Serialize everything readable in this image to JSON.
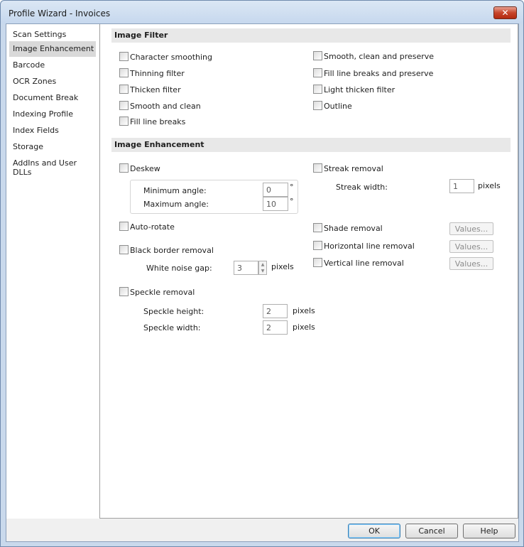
{
  "window": {
    "title": "Profile Wizard - Invoices",
    "close_glyph": "✕"
  },
  "sidebar": {
    "items": [
      {
        "label": "Scan Settings"
      },
      {
        "label": "Image Enhancement"
      },
      {
        "label": "Barcode"
      },
      {
        "label": "OCR Zones"
      },
      {
        "label": "Document Break"
      },
      {
        "label": "Indexing Profile"
      },
      {
        "label": "Index Fields"
      },
      {
        "label": "Storage"
      },
      {
        "label": "AddIns and User DLLs"
      }
    ],
    "selected": "Image Enhancement"
  },
  "image_filter": {
    "heading": "Image Filter",
    "left": [
      {
        "label": "Character smoothing",
        "checked": false
      },
      {
        "label": "Thinning filter",
        "checked": false
      },
      {
        "label": "Thicken filter",
        "checked": false
      },
      {
        "label": "Smooth and clean",
        "checked": false
      },
      {
        "label": "Fill line breaks",
        "checked": false
      }
    ],
    "right": [
      {
        "label": "Smooth, clean and preserve",
        "checked": false
      },
      {
        "label": "Fill line breaks and preserve",
        "checked": false
      },
      {
        "label": "Light thicken filter",
        "checked": false
      },
      {
        "label": "Outline",
        "checked": false
      }
    ]
  },
  "image_enhancement": {
    "heading": "Image Enhancement",
    "deskew": {
      "label": "Deskew",
      "checked": false,
      "min_angle_label": "Minimum angle:",
      "min_angle_value": "0",
      "max_angle_label": "Maximum angle:",
      "max_angle_value": "10",
      "degree_unit": "°"
    },
    "streak": {
      "label": "Streak removal",
      "checked": false,
      "width_label": "Streak width:",
      "width_value": "1",
      "unit": "pixels"
    },
    "auto_rotate": {
      "label": "Auto-rotate",
      "checked": false
    },
    "shade": {
      "label": "Shade removal",
      "checked": false,
      "button": "Values..."
    },
    "black_border": {
      "label": "Black border removal",
      "checked": false,
      "gap_label": "White noise gap:",
      "gap_value": "3",
      "unit": "pixels"
    },
    "horizontal_line": {
      "label": "Horizontal line removal",
      "checked": false,
      "button": "Values..."
    },
    "vertical_line": {
      "label": "Vertical line removal",
      "checked": false,
      "button": "Values..."
    },
    "speckle": {
      "label": "Speckle removal",
      "checked": false,
      "height_label": "Speckle height:",
      "height_value": "2",
      "width_label": "Speckle width:",
      "width_value": "2",
      "unit": "pixels"
    }
  },
  "footer": {
    "ok": "OK",
    "cancel": "Cancel",
    "help": "Help"
  }
}
